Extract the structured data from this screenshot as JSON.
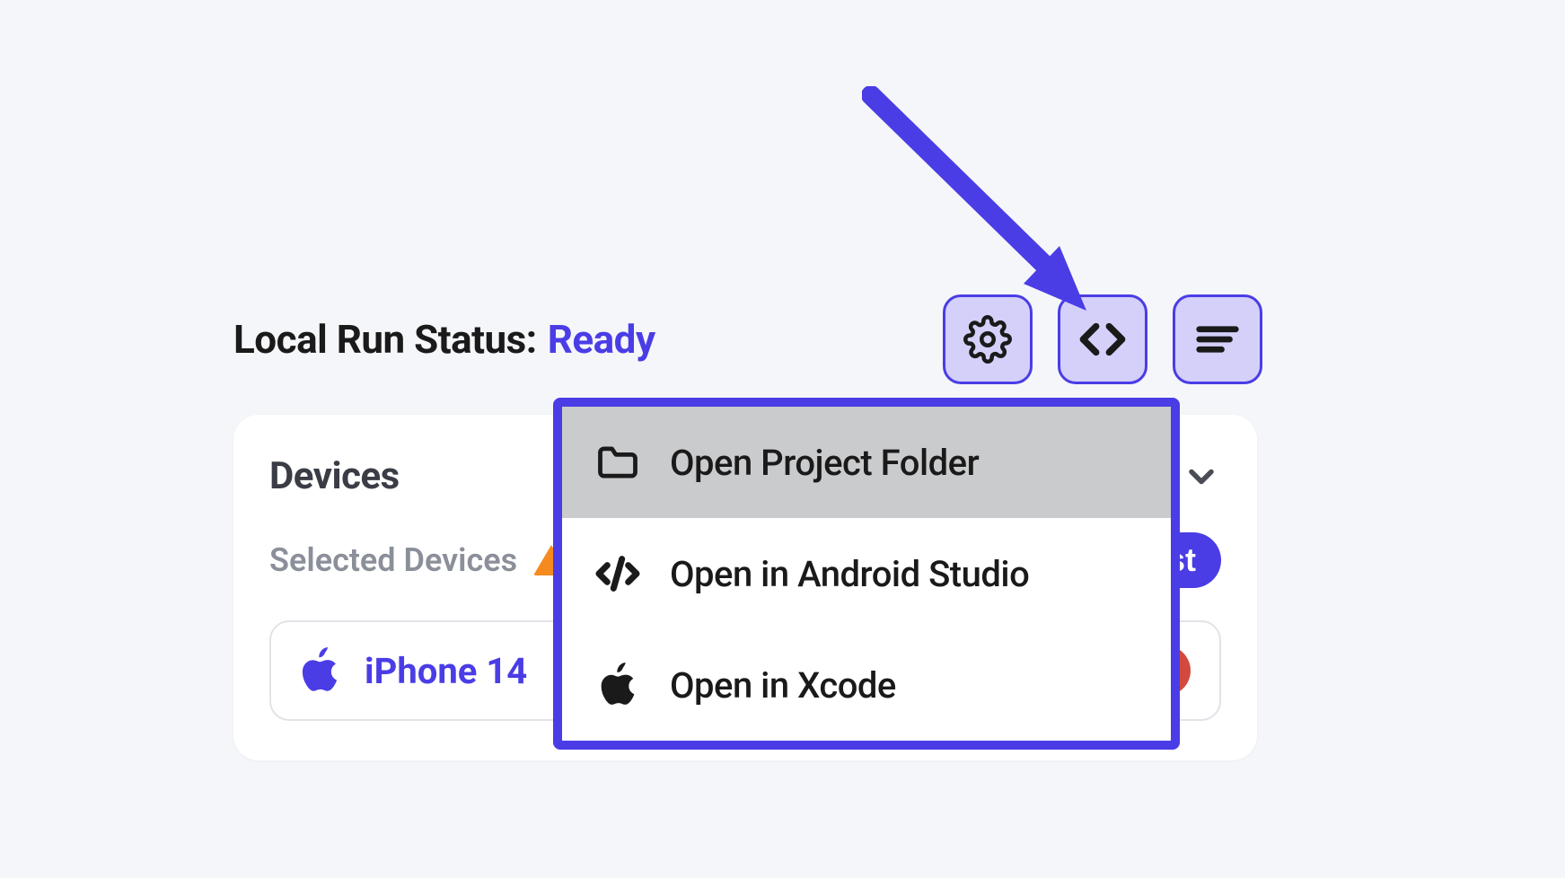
{
  "status": {
    "label": "Local Run Status:",
    "value": "Ready"
  },
  "toolbar": {
    "icons": [
      "gear-icon",
      "code-icon",
      "menu-icon"
    ]
  },
  "devices": {
    "title": "Devices",
    "selected_label": "Selected Devices",
    "warning": true,
    "action_button_visible_text": "st",
    "items": [
      {
        "id": "apple-icon",
        "name": "iPhone 14"
      }
    ]
  },
  "menu": {
    "items": [
      {
        "icon": "folder-icon",
        "label": "Open Project Folder",
        "highlighted": true
      },
      {
        "icon": "code-slash-icon",
        "label": "Open in Android Studio",
        "highlighted": false
      },
      {
        "icon": "apple-icon",
        "label": "Open in Xcode",
        "highlighted": false
      }
    ]
  },
  "colors": {
    "accent": "#4a3de6",
    "accent_light": "#d4d0fa",
    "bg": "#f5f6f9"
  }
}
